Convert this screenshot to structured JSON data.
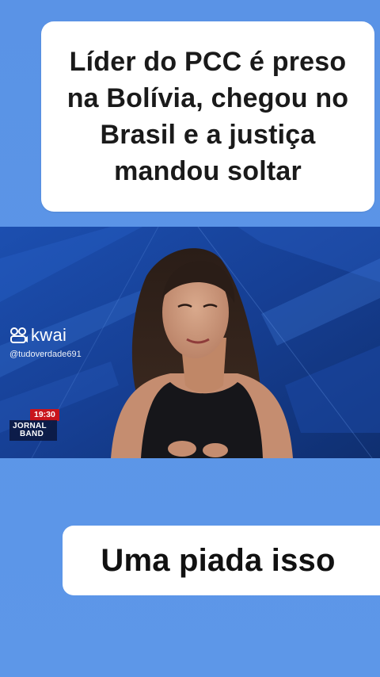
{
  "headline": {
    "text": "Líder do PCC é preso\nna Bolívia, chegou no\nBrasil e a justiça\nmandou soltar"
  },
  "video": {
    "watermark": {
      "brand": "kwai",
      "handle": "@tudoverdade691",
      "icon": "kwai-icon"
    },
    "time_badge": "19:30",
    "program_logo": {
      "line1": "JORNAL",
      "line2": "BAND"
    }
  },
  "comment": {
    "text": "Uma piada isso"
  },
  "colors": {
    "page_background": "#5b94e6",
    "card_background": "#ffffff",
    "time_badge_red": "#c9151c",
    "studio_blue": "#133a86"
  }
}
